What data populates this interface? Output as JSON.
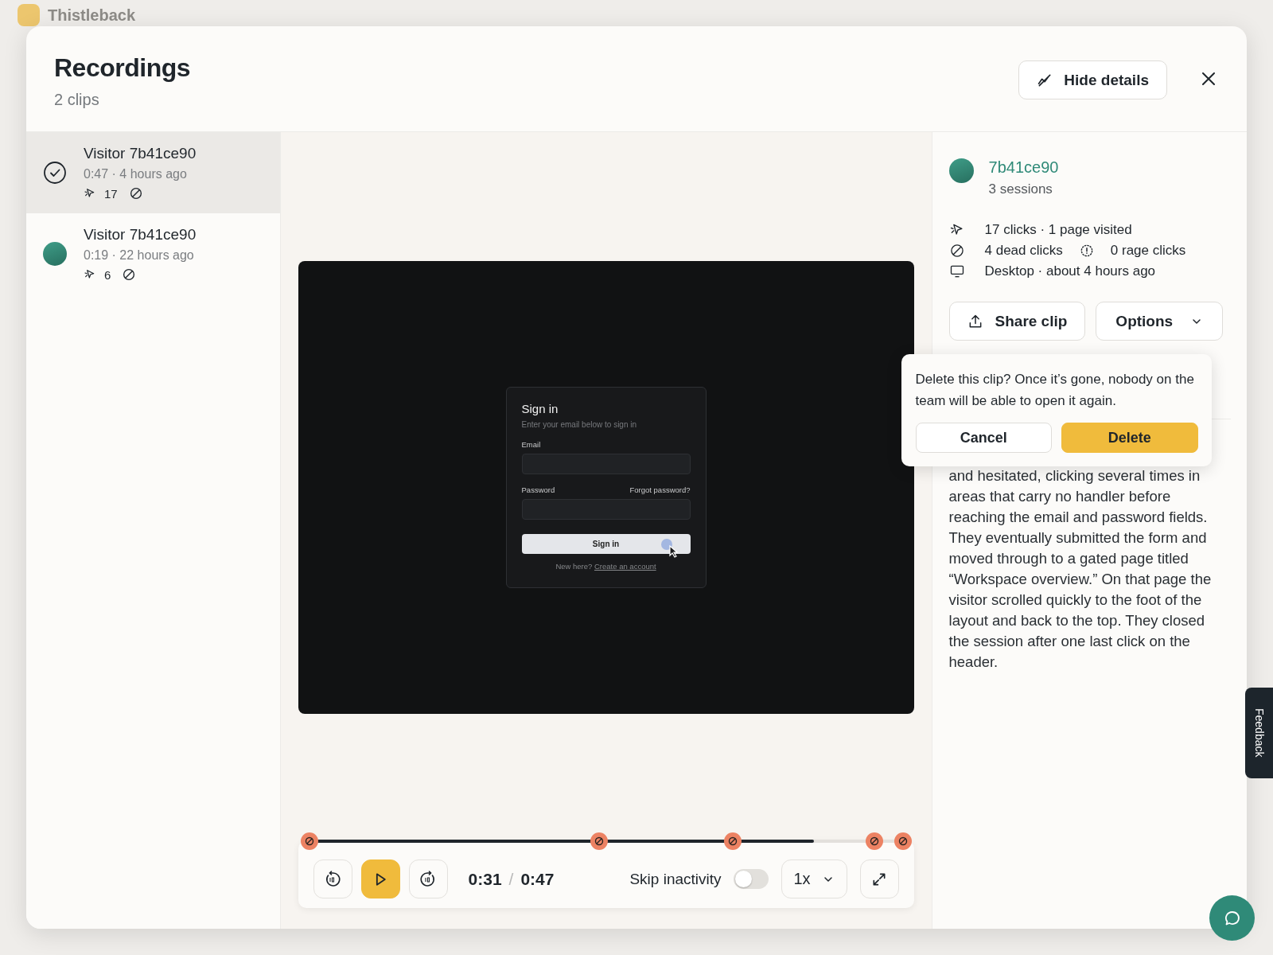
{
  "app": {
    "name": "Thistleback"
  },
  "header": {
    "title": "Recordings",
    "subtitle": "2 clips",
    "hide_details_label": "Hide details"
  },
  "clips": [
    {
      "title": "Visitor 7b41ce90",
      "meta": "0:47 · 4 hours ago",
      "clicks": "17",
      "selected": true
    },
    {
      "title": "Visitor 7b41ce90",
      "meta": "0:19 · 22 hours ago",
      "clicks": "6",
      "selected": false
    }
  ],
  "video": {
    "form": {
      "title": "Sign in",
      "subtitle": "Enter your email below to sign in",
      "email_label": "Email",
      "password_label": "Password",
      "forgot": "Forgot password?",
      "button": "Sign in",
      "footer": "New here?",
      "footer_link": "Create an account"
    }
  },
  "player": {
    "progress": {
      "level": 0.85
    },
    "markers": [
      {
        "level": 0
      },
      {
        "level": 0.488
      },
      {
        "level": 0.714
      },
      {
        "level": 0.952
      },
      {
        "level": 1
      }
    ],
    "current": "0:31",
    "separator": "/",
    "duration": "0:47",
    "skip_label": "Skip inactivity",
    "skip_on": false,
    "speed": "1x"
  },
  "details": {
    "visitor_id": "7b41ce90",
    "sessions": "3 sessions",
    "stat_rows": [
      {
        "items": [
          {
            "kind": "clicks",
            "text": "17 clicks · 1 page visited"
          }
        ]
      },
      {
        "items": [
          {
            "kind": "dead",
            "text": "4 dead clicks"
          },
          {
            "kind": "rage",
            "text": "0 rage clicks"
          }
        ]
      },
      {
        "items": [
          {
            "kind": "device",
            "text": "Desktop · about 4 hours ago"
          }
        ]
      }
    ],
    "share_label": "Share clip",
    "options_label": "Options",
    "description": "and hesitated, clicking several times in areas that carry no handler before reaching the email and password fields. They eventually submitted the form and moved through to a gated page titled “Workspace overview.” On that page the visitor scrolled quickly to the foot of the layout and back to the top. They closed the session after one last click on the header."
  },
  "confirm": {
    "message": "Delete this clip? Once it’s gone, nobody on the team will be able to open it again.",
    "cancel": "Cancel",
    "delete": "Delete"
  },
  "feedback": "Feedback"
}
